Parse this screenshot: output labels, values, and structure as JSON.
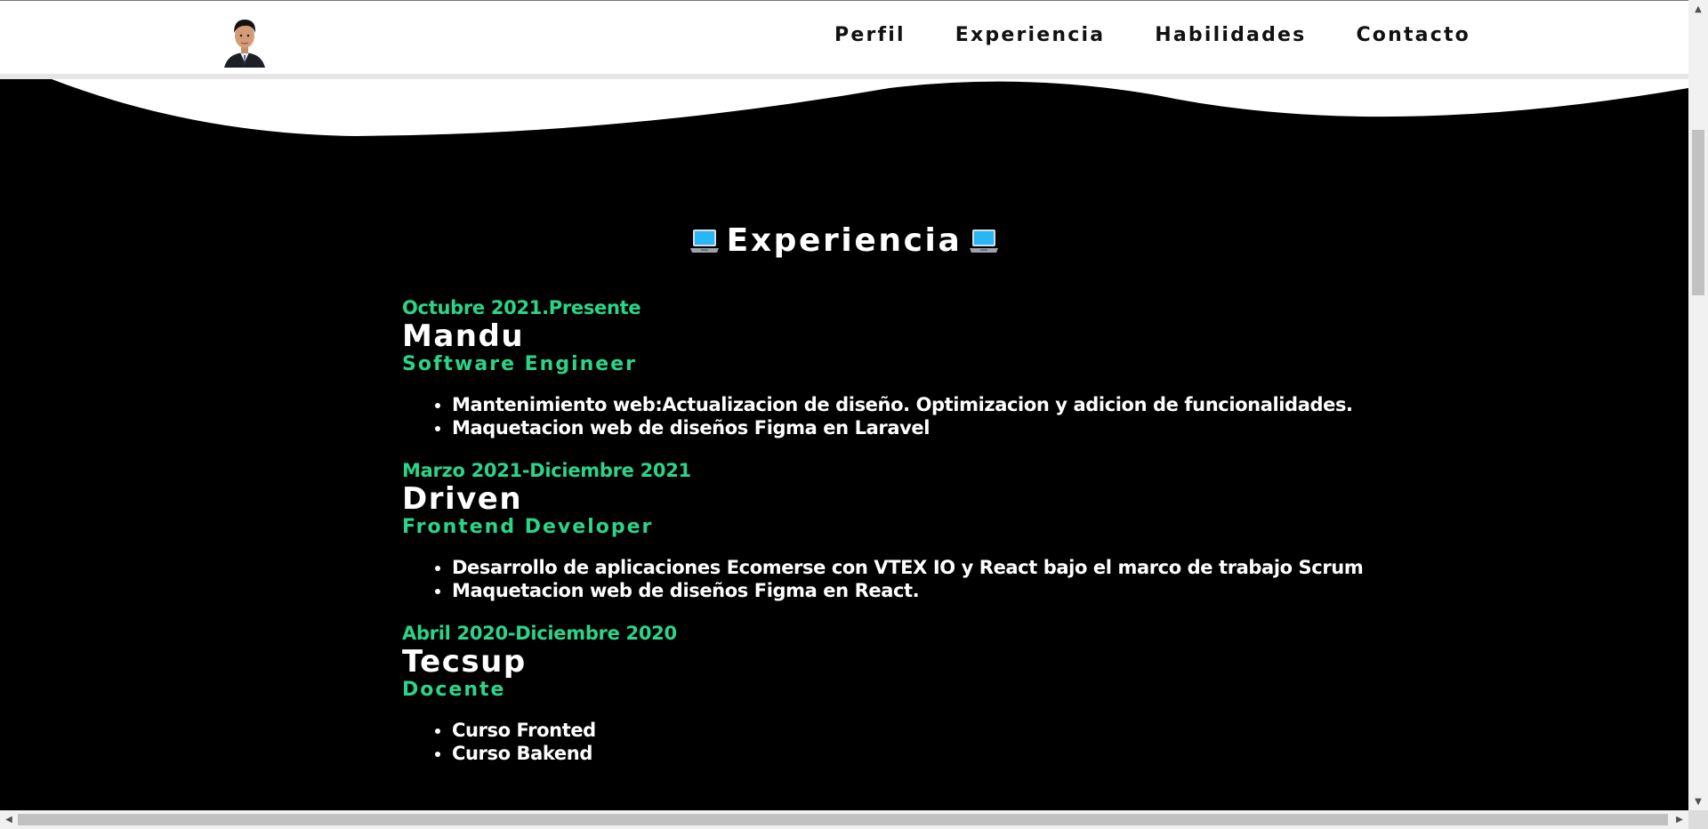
{
  "nav": {
    "items": [
      {
        "label": "Perfil"
      },
      {
        "label": "Experiencia"
      },
      {
        "label": "Habilidades"
      },
      {
        "label": "Contacto"
      }
    ]
  },
  "experience": {
    "title": "Experiencia",
    "items": [
      {
        "period": "Octubre 2021.Presente",
        "company": "Mandu",
        "role": "Software Engineer",
        "tasks": [
          "Mantenimiento web:Actualizacion de diseño. Optimizacion y adicion de funcionalidades.",
          "Maquetacion web de diseños Figma en Laravel"
        ]
      },
      {
        "period": "Marzo 2021-Diciembre 2021",
        "company": "Driven",
        "role": "Frontend Developer",
        "tasks": [
          "Desarrollo de aplicaciones Ecomerse con VTEX IO y React bajo el marco de trabajo Scrum",
          "Maquetacion web de diseños Figma en React."
        ]
      },
      {
        "period": "Abril 2020-Diciembre 2020",
        "company": "Tecsup",
        "role": "Docente",
        "tasks": [
          "Curso Fronted",
          "Curso Bakend"
        ]
      }
    ]
  },
  "colors": {
    "accent": "#2bd488",
    "background": "#000000",
    "header": "#ffffff"
  },
  "icons": {
    "title": "laptop-icon",
    "brand": "avatar"
  }
}
